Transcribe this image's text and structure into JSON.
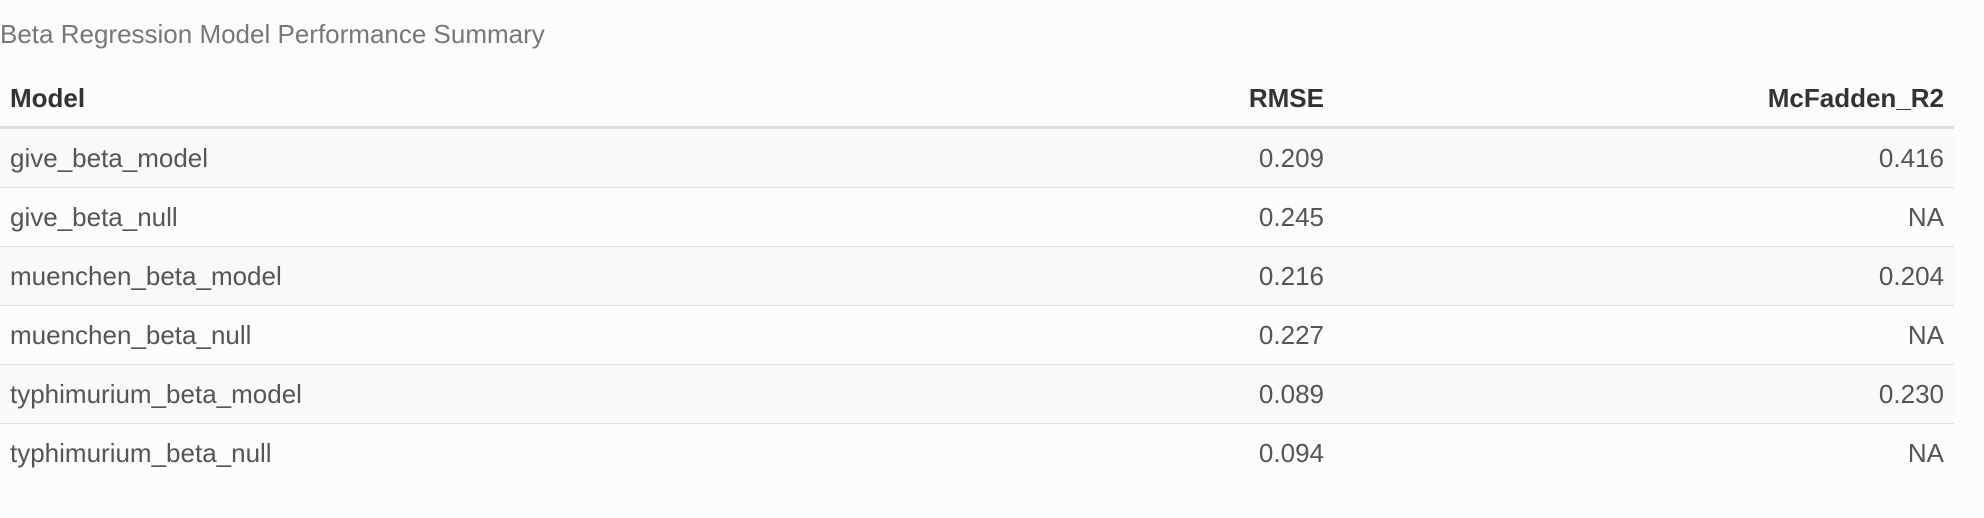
{
  "caption": "Beta Regression Model Performance Summary",
  "table": {
    "headers": [
      "Model",
      "RMSE",
      "McFadden_R2"
    ],
    "rows": [
      [
        "give_beta_model",
        "0.209",
        "0.416"
      ],
      [
        "give_beta_null",
        "0.245",
        "NA"
      ],
      [
        "muenchen_beta_model",
        "0.216",
        "0.204"
      ],
      [
        "muenchen_beta_null",
        "0.227",
        "NA"
      ],
      [
        "typhimurium_beta_model",
        "0.089",
        "0.230"
      ],
      [
        "typhimurium_beta_null",
        "0.094",
        "NA"
      ]
    ]
  }
}
